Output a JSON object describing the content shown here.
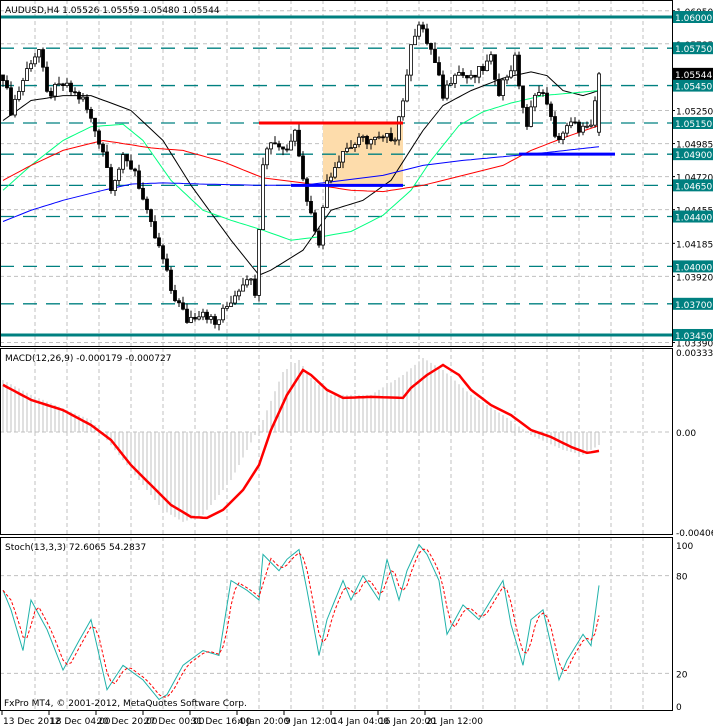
{
  "header": {
    "symbol_info": "AUDUSD,H4  1.05526 1.05559 1.05480 1.05544",
    "macd_info": "MACD(12,26,9) -0.000179 -0.000727",
    "stoch_info": "Stoch(13,3,3) 72.6065 54.2837",
    "copyright": "FxPro MT4, © 2001-2012, MetaQuotes Software Corp."
  },
  "colors": {
    "level": "#008080",
    "ma_black": "#000000",
    "ma_green": "#00ff7f",
    "ma_red": "#ff0000",
    "ma_blue": "#0000ff",
    "rect": "#fddcab",
    "stoch_main": "#20b2aa",
    "stoch_signal": "#ff0000",
    "macd_hist": "#c0c0c0",
    "macd_signal": "#ff0000"
  },
  "chart_data": [
    {
      "type": "candlestick",
      "title": "AUDUSD,H4",
      "ohlc_last": {
        "open": 1.05526,
        "high": 1.05559,
        "low": 1.0548,
        "close": 1.05544
      },
      "current_price": "1.05544",
      "bars": 150,
      "close_path": [
        [
          0,
          1.05535
        ],
        [
          2,
          1.05254
        ],
        [
          7,
          1.05655
        ],
        [
          9,
          1.05735
        ],
        [
          11,
          1.05375
        ],
        [
          15,
          1.05455
        ],
        [
          20,
          1.05334
        ],
        [
          25,
          1.04933
        ],
        [
          27,
          1.04653
        ],
        [
          30,
          1.04853
        ],
        [
          33,
          1.04773
        ],
        [
          36,
          1.04412
        ],
        [
          40,
          1.04051
        ],
        [
          42,
          1.03811
        ],
        [
          46,
          1.0357
        ],
        [
          50,
          1.0365
        ],
        [
          53,
          1.0353
        ],
        [
          57,
          1.03731
        ],
        [
          61,
          1.03931
        ],
        [
          63,
          1.03811
        ],
        [
          65,
          1.04853
        ],
        [
          67,
          1.05014
        ],
        [
          71,
          1.04933
        ],
        [
          73,
          1.05134
        ],
        [
          75,
          1.04693
        ],
        [
          77,
          1.04412
        ],
        [
          79,
          1.04212
        ],
        [
          81,
          1.04693
        ],
        [
          85,
          1.04933
        ],
        [
          90,
          1.05014
        ],
        [
          95,
          1.05014
        ],
        [
          98,
          1.05054
        ],
        [
          101,
          1.05495
        ],
        [
          102,
          1.05816
        ],
        [
          104,
          1.05936
        ],
        [
          107,
          1.05735
        ],
        [
          110,
          1.05375
        ],
        [
          113,
          1.05575
        ],
        [
          117,
          1.05495
        ],
        [
          122,
          1.05655
        ],
        [
          124,
          1.05415
        ],
        [
          128,
          1.05655
        ],
        [
          131,
          1.05094
        ],
        [
          133,
          1.05415
        ],
        [
          136,
          1.05334
        ],
        [
          138,
          1.05014
        ],
        [
          142,
          1.05134
        ],
        [
          146,
          1.05094
        ],
        [
          147,
          1.05094
        ],
        [
          149,
          1.05544
        ]
      ],
      "moving_averages": [
        {
          "name": "ma_black",
          "points": [
            [
              0,
              1.0517
            ],
            [
              7,
              1.0533
            ],
            [
              15,
              1.0537
            ],
            [
              22,
              1.0537
            ],
            [
              32,
              1.0525
            ],
            [
              40,
              1.0501
            ],
            [
              47,
              1.0465
            ],
            [
              57,
              1.0421
            ],
            [
              64,
              1.0393
            ],
            [
              67,
              1.0397
            ],
            [
              75,
              1.0413
            ],
            [
              82,
              1.0445
            ],
            [
              90,
              1.0453
            ],
            [
              97,
              1.0469
            ],
            [
              105,
              1.0509
            ],
            [
              110,
              1.0529
            ],
            [
              117,
              1.0541
            ],
            [
              125,
              1.0551
            ],
            [
              132,
              1.0556
            ],
            [
              136,
              1.0553
            ],
            [
              140,
              1.0541
            ],
            [
              145,
              1.0537
            ],
            [
              149,
              1.0541
            ]
          ]
        },
        {
          "name": "ma_green",
          "points": [
            [
              0,
              1.0461
            ],
            [
              7,
              1.0481
            ],
            [
              15,
              1.0501
            ],
            [
              22,
              1.0512
            ],
            [
              30,
              1.0514
            ],
            [
              35,
              1.0501
            ],
            [
              42,
              1.0469
            ],
            [
              50,
              1.0445
            ],
            [
              57,
              1.0437
            ],
            [
              65,
              1.0429
            ],
            [
              72,
              1.0421
            ],
            [
              80,
              1.0424
            ],
            [
              87,
              1.0428
            ],
            [
              95,
              1.0441
            ],
            [
              102,
              1.0461
            ],
            [
              107,
              1.0485
            ],
            [
              114,
              1.0513
            ],
            [
              120,
              1.0524
            ],
            [
              127,
              1.0531
            ],
            [
              135,
              1.0537
            ],
            [
              142,
              1.0539
            ],
            [
              149,
              1.0541
            ]
          ]
        },
        {
          "name": "ma_red",
          "points": [
            [
              0,
              1.0469
            ],
            [
              7,
              1.0481
            ],
            [
              15,
              1.0493
            ],
            [
              25,
              1.0501
            ],
            [
              37,
              1.0495
            ],
            [
              45,
              1.0493
            ],
            [
              55,
              1.0484
            ],
            [
              65,
              1.0471
            ],
            [
              75,
              1.0467
            ],
            [
              87,
              1.0461
            ],
            [
              95,
              1.046
            ],
            [
              105,
              1.0465
            ],
            [
              115,
              1.0473
            ],
            [
              125,
              1.0481
            ],
            [
              132,
              1.0493
            ],
            [
              140,
              1.0503
            ],
            [
              149,
              1.0513
            ]
          ]
        },
        {
          "name": "ma_blue",
          "points": [
            [
              0,
              1.0436
            ],
            [
              7,
              1.0445
            ],
            [
              15,
              1.0453
            ],
            [
              25,
              1.0461
            ],
            [
              32,
              1.0466
            ],
            [
              40,
              1.0467
            ],
            [
              50,
              1.0466
            ],
            [
              65,
              1.0465
            ],
            [
              75,
              1.0465
            ],
            [
              85,
              1.0469
            ],
            [
              95,
              1.0473
            ],
            [
              105,
              1.0481
            ],
            [
              115,
              1.0485
            ],
            [
              125,
              1.0488
            ],
            [
              135,
              1.0491
            ],
            [
              149,
              1.0496
            ]
          ]
        }
      ],
      "levels": [
        {
          "price": 1.06,
          "label": "1.06000",
          "style": "solid"
        },
        {
          "price": 1.0575,
          "label": "1.05750",
          "style": "dashed"
        },
        {
          "price": 1.0545,
          "label": "1.05450",
          "style": "dashed"
        },
        {
          "price": 1.0515,
          "label": "1.05150",
          "style": "dashed"
        },
        {
          "price": 1.049,
          "label": "1.04900",
          "style": "dashed"
        },
        {
          "price": 1.0465,
          "label": "1.04650",
          "style": "dashed"
        },
        {
          "price": 1.044,
          "label": "1.04400",
          "style": "dashed"
        },
        {
          "price": 1.04,
          "label": "1.04000",
          "style": "dashed"
        },
        {
          "price": 1.037,
          "label": "1.03700",
          "style": "dashed"
        },
        {
          "price": 1.0345,
          "label": "1.03450",
          "style": "solid"
        }
      ],
      "rectangle": {
        "bar_from": 80,
        "bar_to": 100,
        "price_top": 1.0515,
        "price_bottom": 1.0465
      },
      "trend_lines": [
        {
          "color": "ma_red",
          "bar_from": 64,
          "bar_to": 100,
          "price": 1.0515
        },
        {
          "color": "ma_blue",
          "bar_from": 72,
          "bar_to": 100,
          "price": 1.0465
        },
        {
          "color": "ma_blue",
          "bar_from": 129,
          "bar_to": 153,
          "price": 1.049
        }
      ],
      "y_ticks": [
        "1.06050",
        "1.05785",
        "1.05250",
        "1.04985",
        "1.04720",
        "1.04455",
        "1.04185",
        "1.03920",
        "1.03390"
      ],
      "y_tick_values": [
        1.0605,
        1.05785,
        1.0525,
        1.04985,
        1.0472,
        1.04455,
        1.04185,
        1.0392,
        1.0339
      ],
      "x_ticks": [
        "13 Dec 2012",
        "18 Dec 04:00",
        "20 Dec 20:00",
        "27 Dec 00:00",
        "31 Dec 16:00",
        "4 Jan 20:00",
        "9 Jan 12:00",
        "14 Jan 04:00",
        "16 Jan 20:00",
        "21 Jan 12:00"
      ]
    },
    {
      "type": "histogram+line",
      "title": "MACD(12,26,9)",
      "ylim": [
        -0.00406,
        0.003335
      ],
      "y_ticks": [
        "0.003335",
        "0.00",
        "-0.00406"
      ],
      "y_tick_values": [
        0.003335,
        0,
        -0.00406
      ],
      "histogram": [
        [
          0,
          0.00209
        ],
        [
          7,
          0.00149
        ],
        [
          22,
          0.00048
        ],
        [
          32,
          -0.00153
        ],
        [
          40,
          -0.00313
        ],
        [
          45,
          -0.00361
        ],
        [
          50,
          -0.00333
        ],
        [
          57,
          -0.00193
        ],
        [
          65,
          0.00048
        ],
        [
          70,
          0.00241
        ],
        [
          74,
          0.00289
        ],
        [
          77,
          0.00217
        ],
        [
          82,
          0.00149
        ],
        [
          92,
          0.00149
        ],
        [
          100,
          0.00229
        ],
        [
          105,
          0.00297
        ],
        [
          110,
          0.00249
        ],
        [
          117,
          0.00149
        ],
        [
          125,
          0.00068
        ],
        [
          132,
          -0.00012
        ],
        [
          140,
          -0.00072
        ],
        [
          145,
          -0.00092
        ],
        [
          149,
          -0.00052
        ]
      ],
      "signal": [
        [
          0,
          0.00189
        ],
        [
          7,
          0.00129
        ],
        [
          15,
          0.00088
        ],
        [
          22,
          0.00028
        ],
        [
          27,
          -0.00032
        ],
        [
          32,
          -0.00133
        ],
        [
          37,
          -0.00213
        ],
        [
          42,
          -0.00293
        ],
        [
          47,
          -0.00341
        ],
        [
          51,
          -0.00345
        ],
        [
          55,
          -0.00313
        ],
        [
          60,
          -0.00233
        ],
        [
          64,
          -0.00133
        ],
        [
          67,
          8e-05
        ],
        [
          71,
          0.00149
        ],
        [
          75,
          0.00249
        ],
        [
          77,
          0.00229
        ],
        [
          81,
          0.00169
        ],
        [
          85,
          0.00137
        ],
        [
          92,
          0.00141
        ],
        [
          100,
          0.00137
        ],
        [
          102,
          0.00177
        ],
        [
          106,
          0.00229
        ],
        [
          110,
          0.00269
        ],
        [
          114,
          0.00229
        ],
        [
          117,
          0.00169
        ],
        [
          122,
          0.00108
        ],
        [
          127,
          0.00068
        ],
        [
          132,
          8e-05
        ],
        [
          137,
          -0.0002
        ],
        [
          142,
          -0.0006
        ],
        [
          146,
          -0.00084
        ],
        [
          149,
          -0.00076
        ]
      ]
    },
    {
      "type": "line",
      "title": "Stoch(13,3,3)",
      "ylim": [
        0,
        100
      ],
      "y_ticks": [
        "100",
        "80",
        "20",
        "0"
      ],
      "y_tick_values": [
        100,
        80,
        20,
        0
      ],
      "main": [
        [
          0,
          71
        ],
        [
          2,
          59
        ],
        [
          5,
          34
        ],
        [
          7,
          65
        ],
        [
          11,
          47
        ],
        [
          15,
          22
        ],
        [
          19,
          40
        ],
        [
          22,
          53
        ],
        [
          26,
          10
        ],
        [
          30,
          25
        ],
        [
          35,
          16
        ],
        [
          39,
          4
        ],
        [
          41,
          7
        ],
        [
          45,
          25
        ],
        [
          50,
          34
        ],
        [
          54,
          31
        ],
        [
          57,
          77
        ],
        [
          61,
          71
        ],
        [
          64,
          65
        ],
        [
          65,
          93
        ],
        [
          69,
          83
        ],
        [
          71,
          90
        ],
        [
          74,
          96
        ],
        [
          76,
          71
        ],
        [
          79,
          31
        ],
        [
          81,
          53
        ],
        [
          85,
          77
        ],
        [
          87,
          65
        ],
        [
          90,
          80
        ],
        [
          94,
          65
        ],
        [
          96,
          90
        ],
        [
          99,
          65
        ],
        [
          101,
          83
        ],
        [
          104,
          99
        ],
        [
          106,
          93
        ],
        [
          109,
          77
        ],
        [
          111,
          44
        ],
        [
          115,
          62
        ],
        [
          119,
          53
        ],
        [
          122,
          65
        ],
        [
          125,
          77
        ],
        [
          127,
          50
        ],
        [
          130,
          25
        ],
        [
          132,
          53
        ],
        [
          135,
          59
        ],
        [
          139,
          16
        ],
        [
          141,
          28
        ],
        [
          145,
          44
        ],
        [
          147,
          37
        ],
        [
          149,
          74
        ]
      ],
      "signal_period": 3
    }
  ]
}
